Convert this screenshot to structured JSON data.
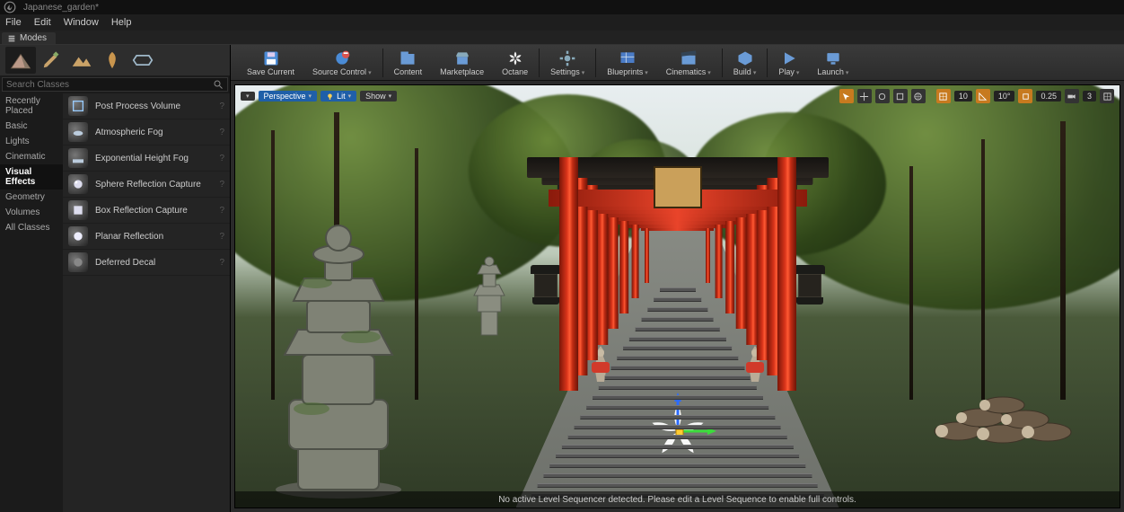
{
  "title_bar": {
    "document": "Japanese_garden*"
  },
  "menu": {
    "items": [
      "File",
      "Edit",
      "Window",
      "Help"
    ]
  },
  "modes_tab": {
    "label": "Modes"
  },
  "modes_panel": {
    "search_placeholder": "Search Classes",
    "categories": [
      "Recently Placed",
      "Basic",
      "Lights",
      "Cinematic",
      "Visual Effects",
      "Geometry",
      "Volumes",
      "All Classes"
    ],
    "selected_category_index": 4,
    "assets": [
      {
        "label": "Post Process Volume"
      },
      {
        "label": "Atmospheric Fog"
      },
      {
        "label": "Exponential Height Fog"
      },
      {
        "label": "Sphere Reflection Capture"
      },
      {
        "label": "Box Reflection Capture"
      },
      {
        "label": "Planar Reflection"
      },
      {
        "label": "Deferred Decal"
      }
    ],
    "question_mark": "?"
  },
  "toolbar": {
    "buttons": [
      {
        "label": "Save Current",
        "icon": "save-icon",
        "dropdown": false
      },
      {
        "label": "Source Control",
        "icon": "source-control-icon",
        "dropdown": true
      },
      {
        "label": "Content",
        "icon": "content-icon",
        "dropdown": false
      },
      {
        "label": "Marketplace",
        "icon": "marketplace-icon",
        "dropdown": false
      },
      {
        "label": "Octane",
        "icon": "octane-icon",
        "dropdown": false
      },
      {
        "label": "Settings",
        "icon": "settings-icon",
        "dropdown": true
      },
      {
        "label": "Blueprints",
        "icon": "blueprints-icon",
        "dropdown": true
      },
      {
        "label": "Cinematics",
        "icon": "cinematics-icon",
        "dropdown": true
      },
      {
        "label": "Build",
        "icon": "build-icon",
        "dropdown": true
      },
      {
        "label": "Play",
        "icon": "play-icon",
        "dropdown": true
      },
      {
        "label": "Launch",
        "icon": "launch-icon",
        "dropdown": true
      }
    ]
  },
  "viewport_bar_left": {
    "menu_tri": "▾",
    "perspective": "Perspective",
    "lit": "Lit",
    "show": "Show"
  },
  "viewport_bar_right": {
    "snap_angle": "10",
    "snap_angle2": "10°",
    "snap_scale": "0.25",
    "cam_speed": "3"
  },
  "status": {
    "message": "No active Level Sequencer detected. Please edit a Level Sequence to enable full controls."
  }
}
